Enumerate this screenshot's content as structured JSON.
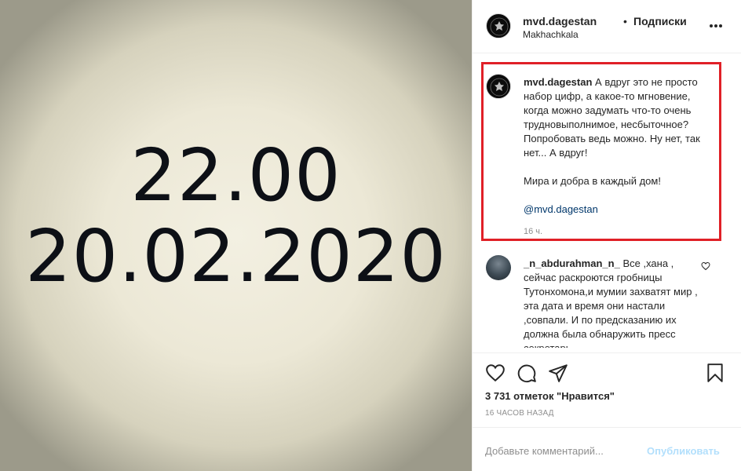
{
  "media": {
    "line1": "22.00",
    "line2": "20.02.2020"
  },
  "header": {
    "username": "mvd.dagestan",
    "separator": "•",
    "follow_label": "Подписки",
    "location": "Makhachkala",
    "more_icon": "more-horizontal-icon"
  },
  "caption": {
    "username": "mvd.dagestan",
    "body": "А вдруг это не просто набор цифр, а какое-то мгновение, когда можно задумать что-то очень трудновыполнимое, несбыточное? Попробовать ведь можно. Ну нет, так нет... А вдруг!",
    "para2": "Мира и добра в каждый дом!",
    "mention": "@mvd.dagestan",
    "time": "16 ч."
  },
  "comment": {
    "username": "_n_abdurahman_n_",
    "text": "Все ,хана , сейчас раскроются гробницы Тутонхомона,и мумии захватят мир , эта дата и время они настали ,совпали. И по предсказанию их должна была обнаружить пресс секретарь"
  },
  "actions": {
    "icons": [
      "heart-icon",
      "comment-icon",
      "share-icon",
      "bookmark-icon"
    ],
    "likes": "3 731 отметок \"Нравится\"",
    "ago": "16 ЧАСОВ НАЗАД"
  },
  "add_comment": {
    "placeholder": "Добавьте комментарий...",
    "post_label": "Опубликовать"
  },
  "colors": {
    "highlight_border": "#e02027",
    "link": "#00376b",
    "post_disabled": "#b2dffc",
    "muted": "#8e8e8e"
  }
}
